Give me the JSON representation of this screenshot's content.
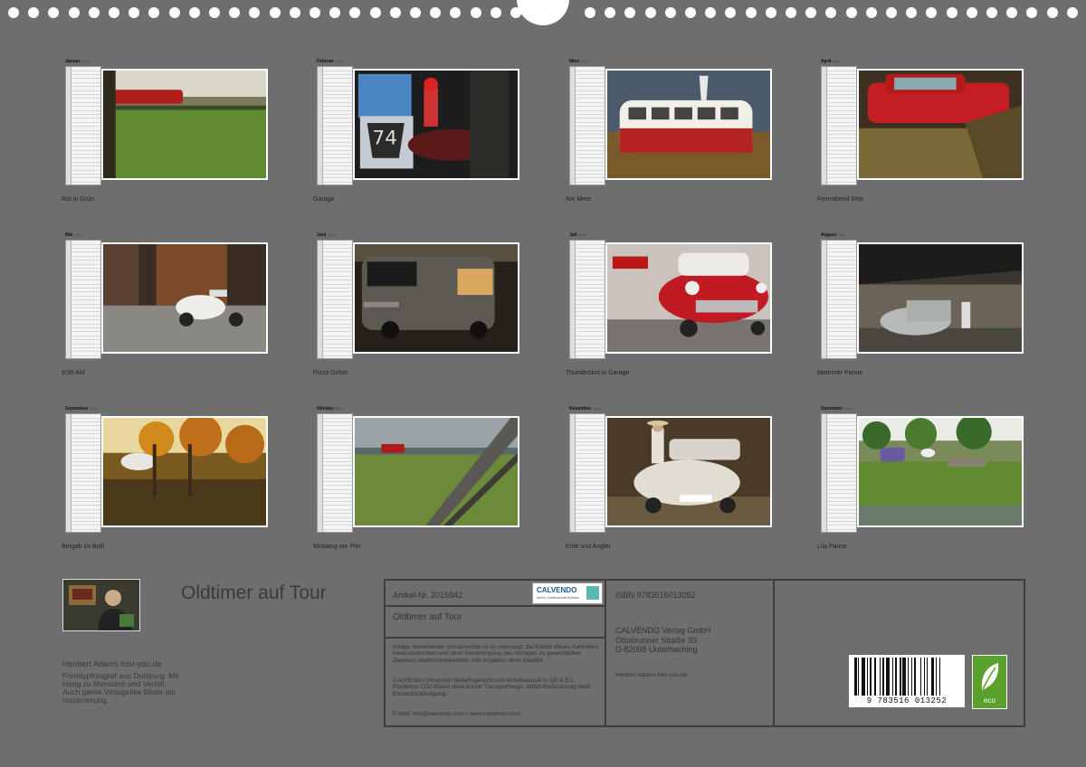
{
  "months": [
    {
      "name": "Januar",
      "year": "2026",
      "caption": "Rot in Grün"
    },
    {
      "name": "Februar",
      "year": "2026",
      "caption": "Garage"
    },
    {
      "name": "März",
      "year": "2026",
      "caption": "Am Meer"
    },
    {
      "name": "April",
      "year": "2026",
      "caption": "Feierabend 66er"
    },
    {
      "name": "Mai",
      "year": "2026",
      "caption": "8:30 AM"
    },
    {
      "name": "Juni",
      "year": "2026",
      "caption": "Pizza Oxfort"
    },
    {
      "name": "Juli",
      "year": "2026",
      "caption": "Thunderbird in Garage"
    },
    {
      "name": "August",
      "year": "2026",
      "caption": "Materner Panne"
    },
    {
      "name": "September",
      "year": "2026",
      "caption": "Bergab im Bulli"
    },
    {
      "name": "Oktober",
      "year": "2026",
      "caption": "Mustang am Pier"
    },
    {
      "name": "November",
      "year": "2026",
      "caption": "Ente und Angler"
    },
    {
      "name": "Dezember",
      "year": "2026",
      "caption": "Lila Pause"
    }
  ],
  "calendar": {
    "title": "Oldtimer auf Tour",
    "author": "Heribert Adams   foto-you.de",
    "bio": "Formtypfotograf aus Duisburg. Mit Hang zu Marodem und Verfall. Auch gerne Vintagelike Bilder als Inszenierung."
  },
  "imprint": {
    "article": "Artikel-Nr. 2015942",
    "product_title": "Oldtimer auf Tour",
    "logo_text": "CALVENDO",
    "logo_sub": "mehr Leidenschaft erleben",
    "rights": "Infolge bestehender Schutzrechte ist es untersagt, die Blätter dieses Kalenders herauszutrennen und ohne Genehmigung des Verlages zu gewerblichen Zwecken weiterzuverwenden. Alle Angaben ohne Gewähr.",
    "climate": "CALVENDO produziert bedarfsgerecht und klimabewusst in DE & EU. Positivere CO2-Bilanz dank kurzer Transportwege. Abfall-Reduzierung dank Einzelstückfertigung.",
    "email": "E-Mail: info@calvendo.com • www.calvendo.com",
    "isbn": "ISBN 9783516013252",
    "publisher1": "CALVENDO Verlag GmbH",
    "publisher2": "Ottobrunner Straße 39",
    "publisher3": "D-82008 Unterhaching",
    "credit": "Heribert Adams foto-you.de",
    "barcode": "9 783516 013252",
    "eco": "eco"
  }
}
